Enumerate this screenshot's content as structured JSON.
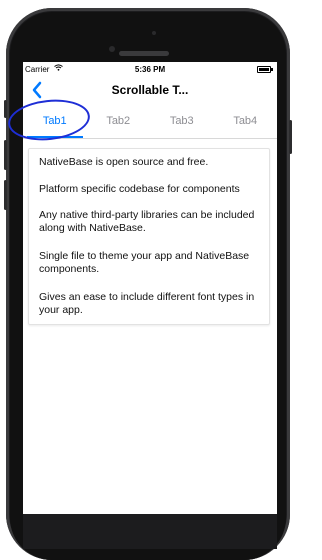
{
  "statusbar": {
    "carrier": "Carrier",
    "wifi_icon": "wifi-icon",
    "time": "5:36 PM",
    "battery_icon": "battery-icon"
  },
  "navbar": {
    "back_icon": "chevron-left-icon",
    "back_glyph": "❮",
    "title": "Scrollable T..."
  },
  "tabs": [
    {
      "label": "Tab1",
      "active": true
    },
    {
      "label": "Tab2",
      "active": false
    },
    {
      "label": "Tab3",
      "active": false
    },
    {
      "label": "Tab4",
      "active": false
    }
  ],
  "content": {
    "items": [
      "NativeBase is open source and free.",
      "Platform specific codebase for components",
      "Any native third-party libraries can be included along with NativeBase.",
      "Single file to theme your app and NativeBase components.",
      "Gives an ease to include different font types in your app."
    ]
  },
  "colors": {
    "accent": "#007aff",
    "annotation": "#1e2ed6",
    "phone_body": "#1c1c1e"
  }
}
